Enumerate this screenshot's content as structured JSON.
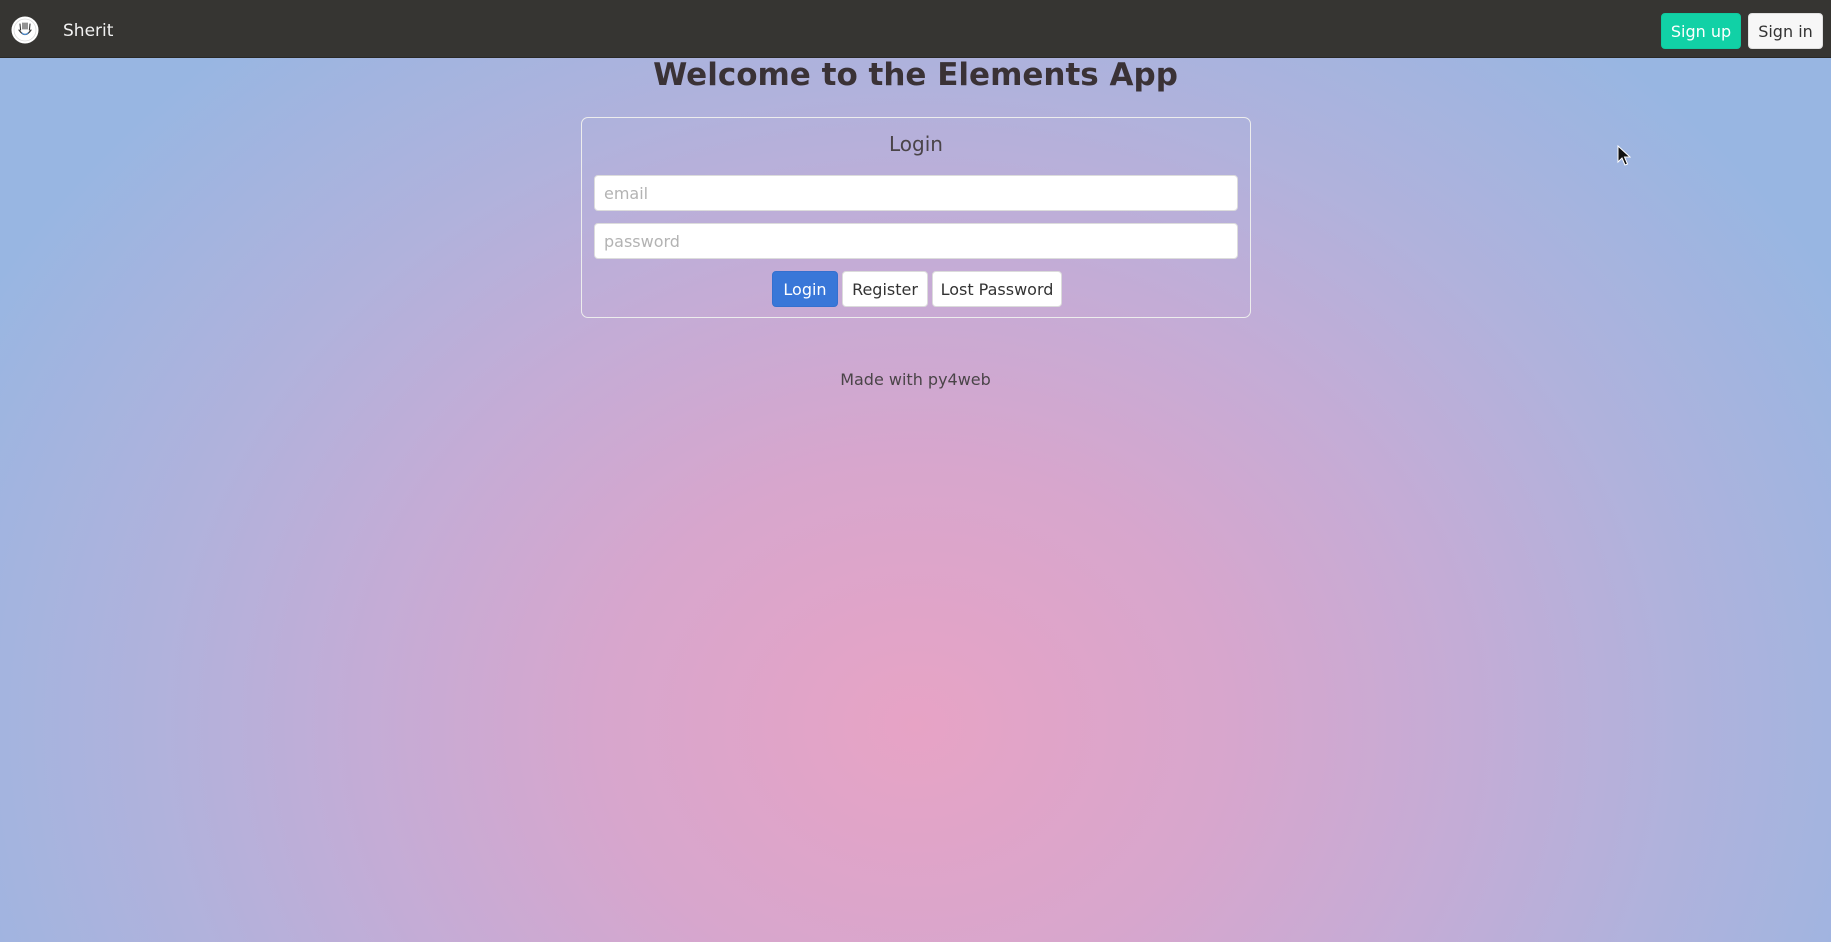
{
  "navbar": {
    "logo_icon": "logo-icon",
    "brand": "Sherit",
    "signup_label": "Sign up",
    "signin_label": "Sign in"
  },
  "page": {
    "title": "Welcome to the Elements App"
  },
  "login": {
    "heading": "Login",
    "email_placeholder": "email",
    "email_value": "",
    "password_placeholder": "password",
    "password_value": "",
    "login_label": "Login",
    "register_label": "Register",
    "lost_password_label": "Lost Password"
  },
  "footer": {
    "text": "Made with py4web"
  },
  "colors": {
    "navbar_bg": "#363532",
    "signup_bg": "#11d1a6",
    "login_bg": "#3977d8",
    "background_center": "#e7a3c5",
    "background_edge": "#98b6e2"
  }
}
